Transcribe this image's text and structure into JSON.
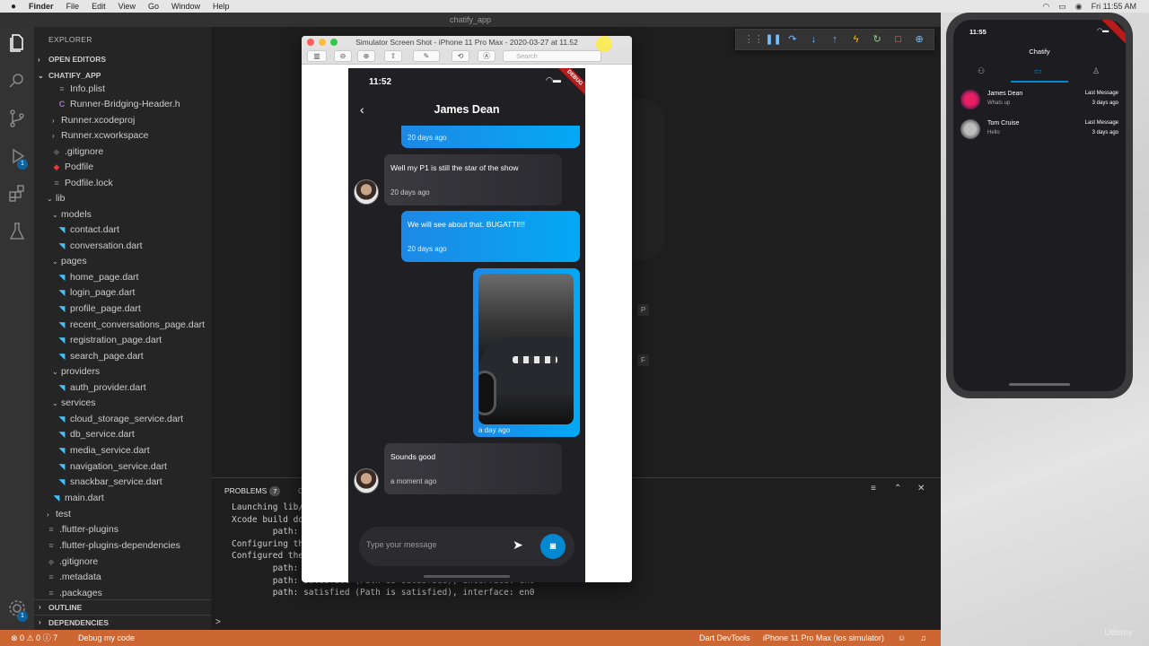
{
  "menubar": {
    "apple": "",
    "items": [
      "Finder",
      "File",
      "Edit",
      "View",
      "Go",
      "Window",
      "Help"
    ],
    "clock": "Fri 11:55 AM"
  },
  "window_title": "chatify_app",
  "explorer": {
    "title": "EXPLORER",
    "open_editors": "OPEN EDITORS",
    "project": "CHATIFY_APP",
    "items": [
      {
        "label": "Info.plist",
        "kind": "file"
      },
      {
        "label": "Runner-Bridging-Header.h",
        "kind": "c"
      },
      {
        "label": "Runner.xcodeproj",
        "kind": "folder"
      },
      {
        "label": "Runner.xcworkspace",
        "kind": "folder"
      },
      {
        "label": ".gitignore",
        "kind": "git"
      },
      {
        "label": "Podfile",
        "kind": "ruby"
      },
      {
        "label": "Podfile.lock",
        "kind": "file"
      },
      {
        "label": "lib",
        "kind": "folder-open"
      },
      {
        "label": "models",
        "kind": "folder-open"
      },
      {
        "label": "contact.dart",
        "kind": "dart"
      },
      {
        "label": "conversation.dart",
        "kind": "dart"
      },
      {
        "label": "pages",
        "kind": "folder-open"
      },
      {
        "label": "home_page.dart",
        "kind": "dart"
      },
      {
        "label": "login_page.dart",
        "kind": "dart"
      },
      {
        "label": "profile_page.dart",
        "kind": "dart"
      },
      {
        "label": "recent_conversations_page.dart",
        "kind": "dart"
      },
      {
        "label": "registration_page.dart",
        "kind": "dart"
      },
      {
        "label": "search_page.dart",
        "kind": "dart"
      },
      {
        "label": "providers",
        "kind": "folder-open"
      },
      {
        "label": "auth_provider.dart",
        "kind": "dart"
      },
      {
        "label": "services",
        "kind": "folder-open"
      },
      {
        "label": "cloud_storage_service.dart",
        "kind": "dart"
      },
      {
        "label": "db_service.dart",
        "kind": "dart"
      },
      {
        "label": "media_service.dart",
        "kind": "dart"
      },
      {
        "label": "navigation_service.dart",
        "kind": "dart"
      },
      {
        "label": "snackbar_service.dart",
        "kind": "dart"
      },
      {
        "label": "main.dart",
        "kind": "dart"
      },
      {
        "label": "test",
        "kind": "folder"
      },
      {
        "label": ".flutter-plugins",
        "kind": "file"
      },
      {
        "label": ".flutter-plugins-dependencies",
        "kind": "file"
      },
      {
        "label": ".gitignore",
        "kind": "git"
      },
      {
        "label": ".metadata",
        "kind": "file"
      },
      {
        "label": ".packages",
        "kind": "file"
      }
    ],
    "outline": "OUTLINE",
    "dependencies": "DEPENDENCIES"
  },
  "activity_badges": {
    "debug": "1",
    "settings": "1"
  },
  "panel": {
    "problems_label": "PROBLEMS",
    "problems_count": "7",
    "other_tab": "O",
    "terminal_lines": [
      "Launching lib/",
      "Xcode build do",
      "        path:",
      "Configuring th",
      "Configured the",
      "        path:",
      "        path: satisfied (Path is satisfied), interface: en0",
      "        path: satisfied (Path is satisfied), interface: en0"
    ],
    "prompt": ">"
  },
  "statusbar": {
    "errors": "0",
    "warnings": "0",
    "info": "7",
    "debug_label": "Debug my code",
    "devtools": "Dart DevTools",
    "device": "iPhone 11 Pro Max (ios simulator)"
  },
  "editor_side_letters": [
    "P",
    "F"
  ],
  "simulator_window": {
    "title": "Simulator Screen Shot - iPhone 11 Pro Max - 2020-03-27 at 11.52",
    "search_placeholder": "Search"
  },
  "chat_screen": {
    "time": "11:52",
    "contact_name": "James Dean",
    "debug_banner": "DEBUG",
    "messages": [
      {
        "dir": "out",
        "text": "",
        "time": "20 days ago"
      },
      {
        "dir": "in",
        "text": "Well my P1 is still the star of the show",
        "time": "20 days ago"
      },
      {
        "dir": "out",
        "text": "We will see about that. BUGATTI!!!",
        "time": "20 days ago"
      },
      {
        "dir": "out-image",
        "text": "",
        "time": "a day ago"
      },
      {
        "dir": "in",
        "text": "Sounds good",
        "time": "a moment ago"
      }
    ],
    "input_placeholder": "Type your message"
  },
  "phone2": {
    "time": "11:55",
    "title": "Chatify",
    "conversations": [
      {
        "name": "James Dean",
        "message": "Whats up",
        "right_top": "Last Message",
        "right_bottom": "3 days ago"
      },
      {
        "name": "Tom Cruise",
        "message": "Hello",
        "right_top": "Last Message",
        "right_bottom": "3 days ago"
      }
    ]
  },
  "watermark": "Udemy",
  "colors": {
    "accent": "#0288d1",
    "statusbar": "#cc6633",
    "bubble_out": "#039be5"
  }
}
